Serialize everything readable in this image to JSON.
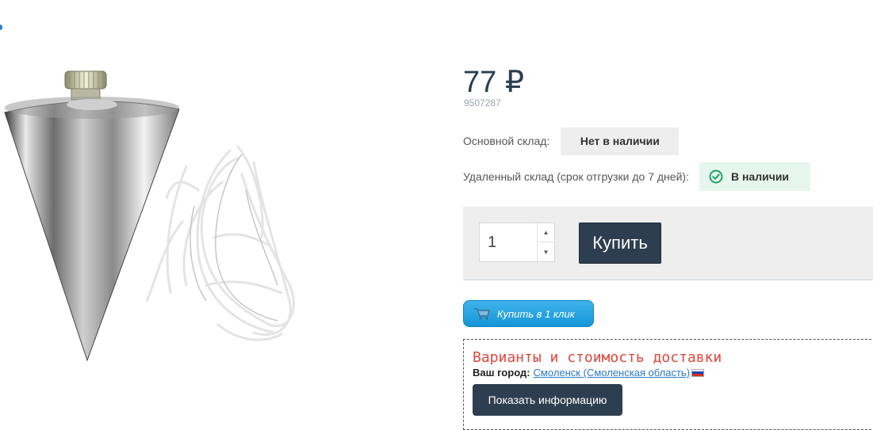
{
  "product": {
    "image_alt": "plumb-bob-with-string",
    "price": "77 ₽",
    "sku": "9507287"
  },
  "stock": {
    "main_label": "Основной склад:",
    "main_status": "Нет в наличии",
    "remote_label": "Удаленный склад (срок отгрузки до 7 дней):",
    "remote_status": "В наличии",
    "remote_icon": "check-circle-icon",
    "in_stock_color": "#1fa36a"
  },
  "purchase": {
    "quantity": "1",
    "buy_label": "Купить",
    "oneclick_label": "Купить в 1 клик",
    "oneclick_icon": "cart-icon"
  },
  "delivery": {
    "title": "Варианты и стоимость доставки",
    "city_label": "Ваш город:",
    "city_value": "Смоленск (Смоленская область)",
    "flag": "russia-flag-icon",
    "show_button": "Показать информацию"
  },
  "colors": {
    "accent_dark": "#2d3e50",
    "oneclick_blue": "#1596d8",
    "delivery_title": "#e0473c"
  }
}
